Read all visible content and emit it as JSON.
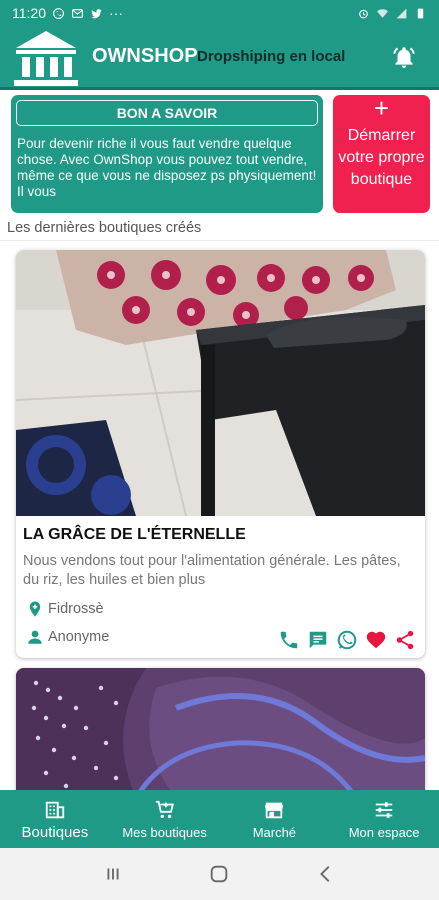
{
  "status_bar": {
    "time": "11:20",
    "dots": "···"
  },
  "app_bar": {
    "title": "OWNSHOP",
    "tagline": "Dropshiping en local"
  },
  "info_card": {
    "title": "BON A SAVOIR",
    "text": "Pour devenir riche il vous faut vendre quelque chose. Avec OwnShop vous pouvez tout vendre, même ce que vous ne disposez ps physiquement! Il vous"
  },
  "start_card": {
    "plus": "+",
    "label": "Démarrer votre propre boutique"
  },
  "section": {
    "label": "Les dernières boutiques créés"
  },
  "shops": [
    {
      "name": "LA GRÂCE DE L'ÉTERNELLE",
      "description": "Nous vendons tout pour l'alimentation générale. Les pâtes, du riz, les huiles et bien plus",
      "location": "Fidrossè",
      "owner": "Anonyme"
    }
  ],
  "bottom_nav": [
    {
      "label": "Boutiques",
      "icon": "store-icon",
      "active": true
    },
    {
      "label": "Mes boutiques",
      "icon": "add-cart-icon",
      "active": false
    },
    {
      "label": "Marché",
      "icon": "market-icon",
      "active": false
    },
    {
      "label": "Mon espace",
      "icon": "sliders-icon",
      "active": false
    }
  ],
  "colors": {
    "primary": "#1e9a86",
    "accent": "#f0214f",
    "heart": "#e8173f"
  }
}
